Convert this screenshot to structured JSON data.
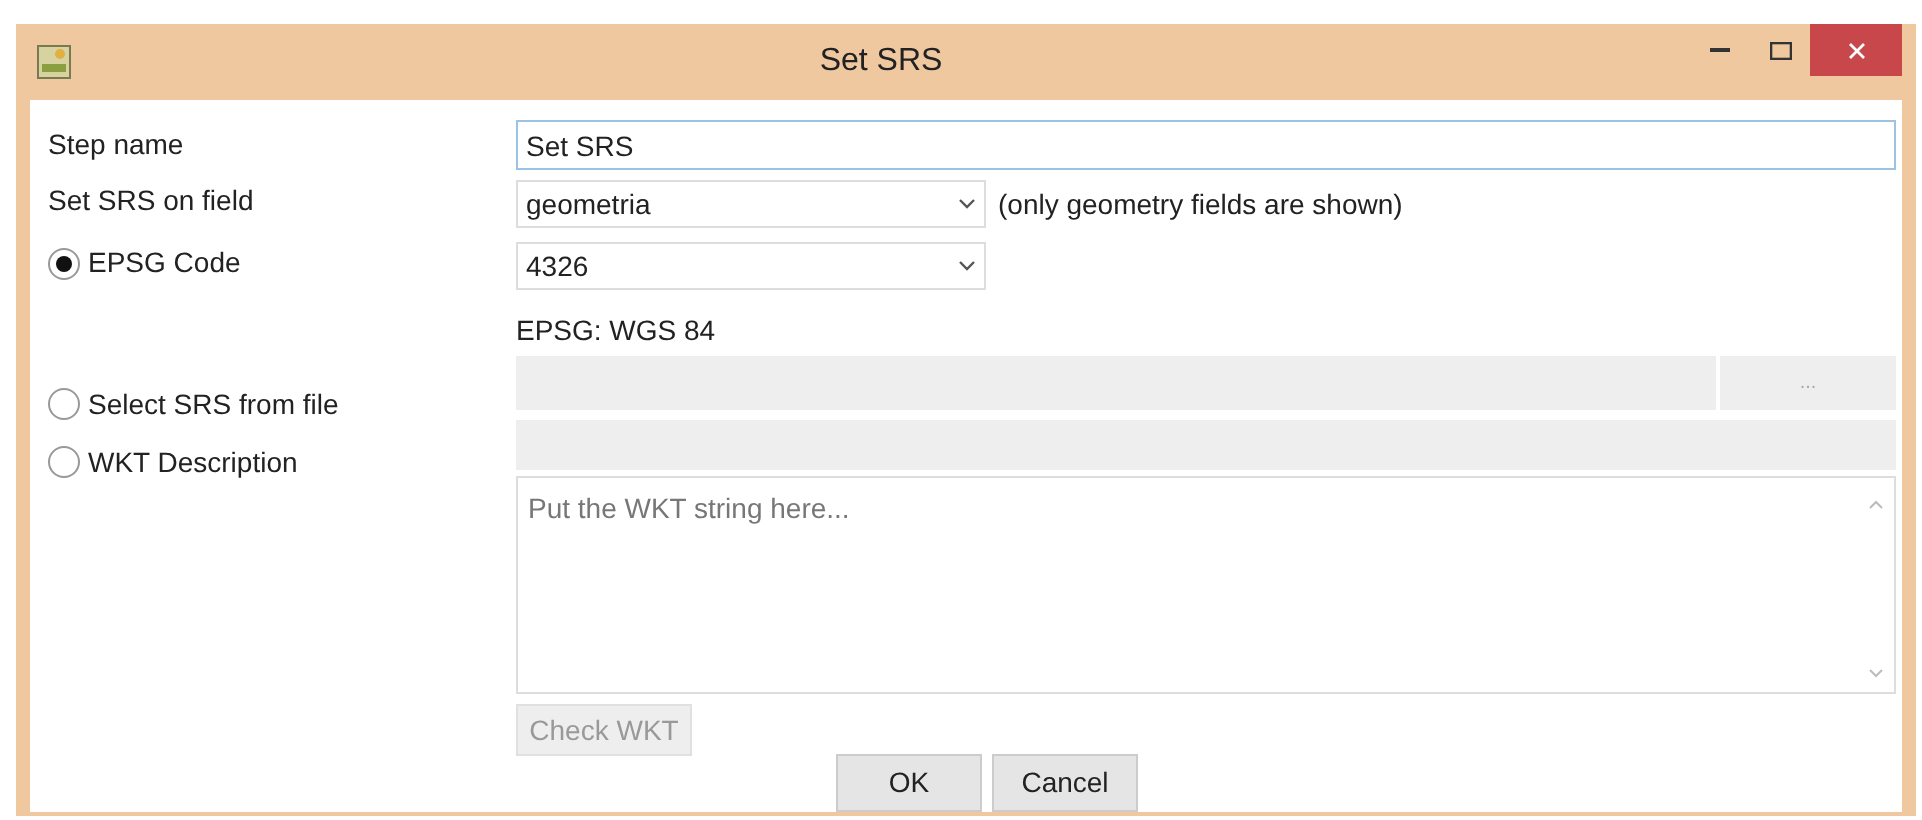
{
  "window": {
    "title": "Set SRS"
  },
  "step_name": {
    "label": "Step name",
    "value": "Set SRS"
  },
  "srs_field": {
    "label": "Set SRS on field",
    "value": "geometria",
    "hint": "(only geometry fields are shown)"
  },
  "options": [
    {
      "label": "EPSG Code",
      "selected": true
    },
    {
      "label": "Select SRS from file",
      "selected": false
    },
    {
      "label": "WKT Description",
      "selected": false
    }
  ],
  "epsg": {
    "value": "4326",
    "description": "EPSG: WGS 84"
  },
  "file": {
    "browse_label": "...",
    "disabled": true
  },
  "wkt": {
    "disabled": true,
    "placeholder": "Put the WKT string here...",
    "check_label": "Check WKT"
  },
  "buttons": [
    {
      "label": "OK"
    },
    {
      "label": "Cancel"
    }
  ]
}
